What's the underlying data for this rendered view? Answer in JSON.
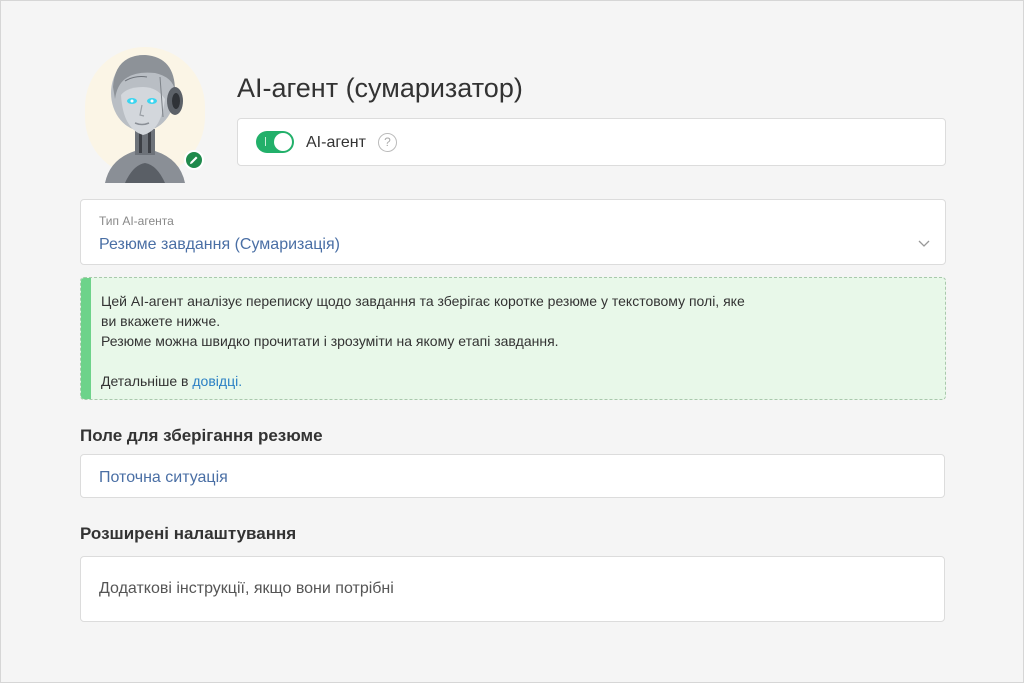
{
  "agent": {
    "title": "AI-агент (сумаризатор)",
    "toggle_label": "AI-агент",
    "toggle_on": true,
    "help_icon": "question-circle-icon",
    "avatar_alt": "robot-avatar"
  },
  "type_select": {
    "label": "Тип AI-агента",
    "value": "Резюме завдання (Сумаризація)"
  },
  "info": {
    "line1": "Цей AI-агент аналізує переписку щодо завдання та зберігає коротке резюме у текстовому полі, яке",
    "line2": "ви вкажете нижче.",
    "line3": "Резюме можна швидко прочитати і зрозуміти на якому етапі завдання.",
    "more_prefix": "Детальніше в ",
    "more_link": "довідці."
  },
  "summary_field": {
    "section_title": "Поле для зберігання резюме",
    "value": "Поточна ситуація"
  },
  "advanced": {
    "section_title": "Розширені налаштування",
    "placeholder": "Додаткові інструкції, якщо вони потрібні"
  },
  "colors": {
    "toggle_on": "#22b06a",
    "info_bg": "#e8f8e9",
    "info_bar": "#6dd38a",
    "link": "#2a7fc4",
    "select_value": "#4a6fa5"
  }
}
